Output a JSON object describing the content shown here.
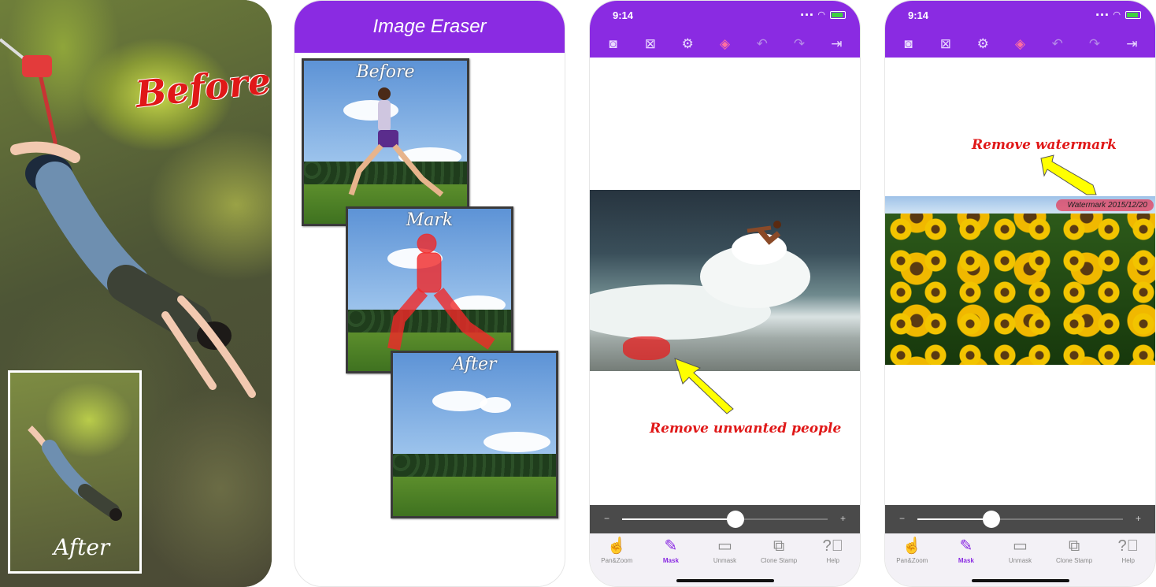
{
  "panel1": {
    "before_label": "Before",
    "after_label": "After"
  },
  "panel2": {
    "title": "Image Eraser",
    "cards": [
      {
        "label": "Before"
      },
      {
        "label": "Mark"
      },
      {
        "label": "After"
      }
    ]
  },
  "panel3": {
    "status": {
      "time": "9:14"
    },
    "toolbar": [
      "camera-icon",
      "close-box-icon",
      "settings-icon",
      "eraser-icon",
      "undo-icon",
      "redo-icon",
      "exit-icon"
    ],
    "callout": "Remove unwanted people",
    "slider": {
      "minus": "−",
      "plus": "+",
      "value": 0.55
    },
    "nav": [
      {
        "label": "Pan&Zoom",
        "icon": "hand-icon"
      },
      {
        "label": "Mask",
        "icon": "brush-icon"
      },
      {
        "label": "Unmask",
        "icon": "roller-icon"
      },
      {
        "label": "Clone Stamp",
        "icon": "stamp-icon"
      },
      {
        "label": "Help",
        "icon": "question-icon"
      }
    ]
  },
  "panel4": {
    "status": {
      "time": "9:14"
    },
    "callout": "Remove watermark",
    "watermark": "Watermark 2015/12/20",
    "slider": {
      "minus": "−",
      "plus": "+",
      "value": 0.36
    },
    "nav": [
      {
        "label": "Pan&Zoom",
        "icon": "hand-icon"
      },
      {
        "label": "Mask",
        "icon": "brush-icon"
      },
      {
        "label": "Unmask",
        "icon": "roller-icon"
      },
      {
        "label": "Clone Stamp",
        "icon": "stamp-icon"
      },
      {
        "label": "Help",
        "icon": "question-icon"
      }
    ]
  },
  "colors": {
    "accent": "#8a2be2",
    "callout": "#e01818",
    "highlight": "#ffff00"
  }
}
